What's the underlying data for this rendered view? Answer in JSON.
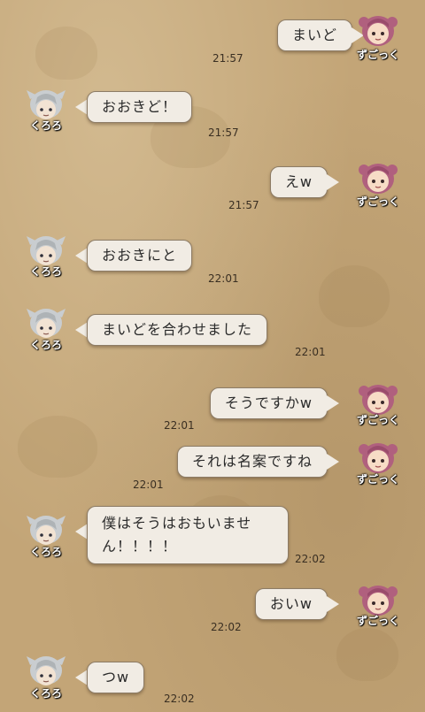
{
  "users": {
    "self": {
      "name": "ずごっく",
      "avatar_icon": "pink-haired-girl-icon"
    },
    "other": {
      "name": "くろろ",
      "avatar_icon": "silver-haired-boy-icon"
    }
  },
  "messages": [
    {
      "sender": "self",
      "text": "まいど",
      "time": "21:57"
    },
    {
      "sender": "other",
      "text": "おおきど！",
      "time": "21:57"
    },
    {
      "sender": "self",
      "text": "えw",
      "time": "21:57"
    },
    {
      "sender": "other",
      "text": "おおきにと",
      "time": "22:01"
    },
    {
      "sender": "other",
      "text": "まいどを合わせました",
      "time": "22:01"
    },
    {
      "sender": "self",
      "text": "そうですかw",
      "time": "22:01"
    },
    {
      "sender": "self",
      "text": "それは名案ですね",
      "time": "22:01"
    },
    {
      "sender": "other",
      "text": "僕はそうはおもいません！！！！",
      "time": "22:02"
    },
    {
      "sender": "self",
      "text": "おいw",
      "time": "22:02"
    },
    {
      "sender": "other",
      "text": "つw",
      "time": "22:02"
    }
  ],
  "colors": {
    "background": "#c3a577",
    "bubble": "#f1ece4",
    "bubble_border": "#8d7c66",
    "name_text": "#ffffff",
    "time_text": "#3a2f22"
  }
}
